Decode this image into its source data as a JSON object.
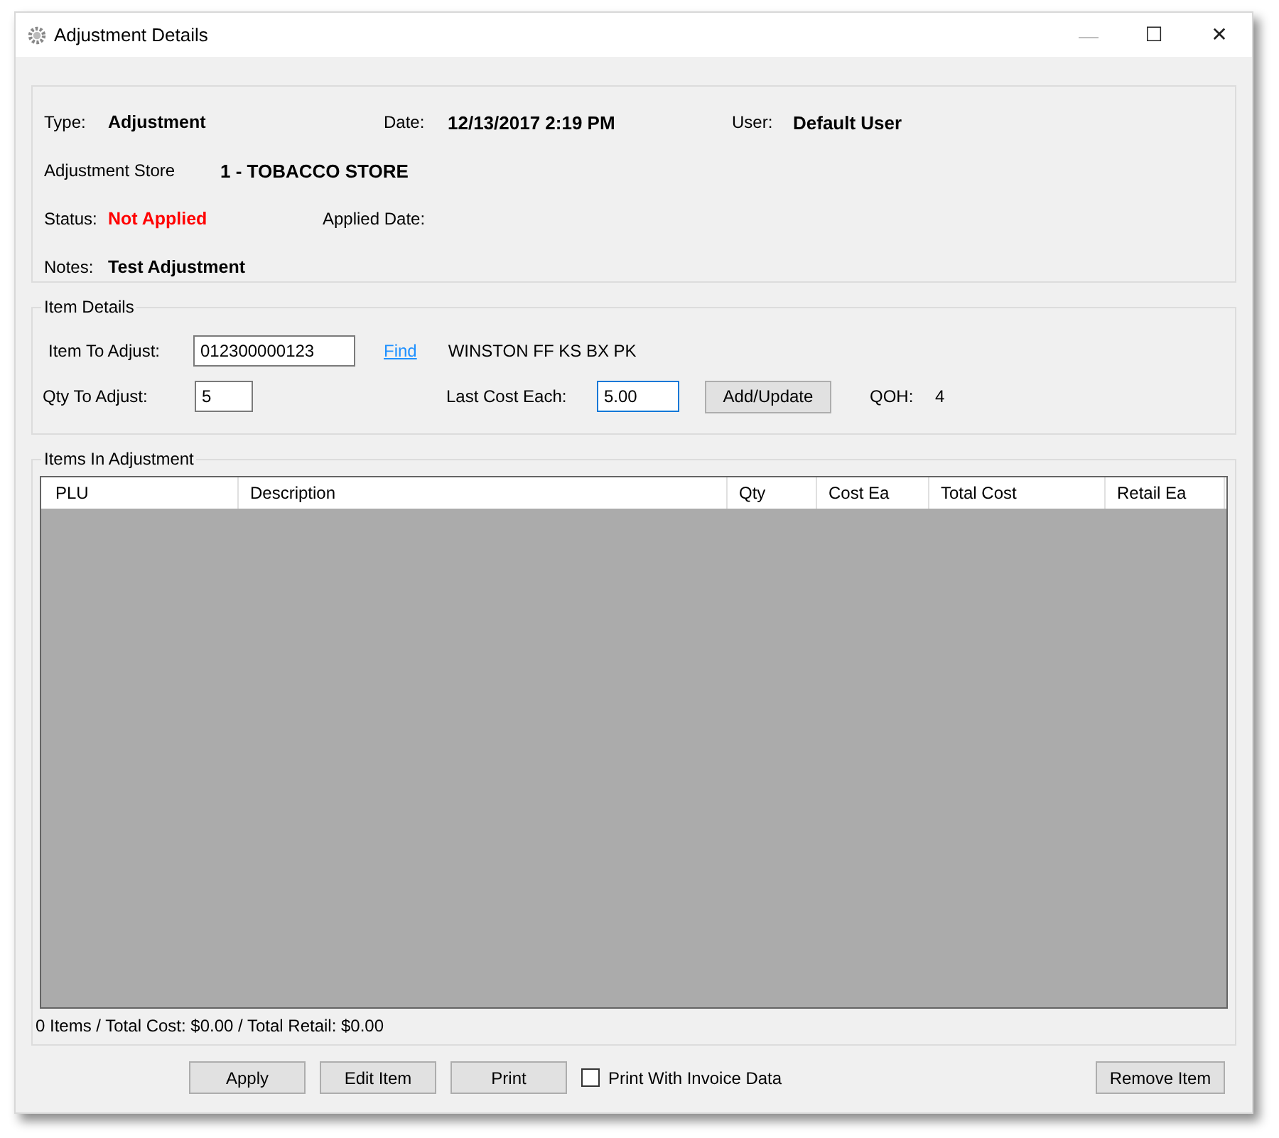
{
  "window": {
    "title": "Adjustment Details",
    "controls": [
      "—",
      "☐",
      "✕"
    ]
  },
  "header": {
    "type_label": "Type:",
    "type_value": "Adjustment",
    "date_label": "Date:",
    "date_value": "12/13/2017 2:19 PM",
    "user_label": "User:",
    "user_value": "Default User",
    "store_label": "Adjustment Store",
    "store_value": "1 - TOBACCO STORE",
    "status_label": "Status:",
    "status_value": "Not Applied",
    "applied_date_label": "Applied Date:",
    "notes_label": "Notes:",
    "notes_value": "Test Adjustment"
  },
  "item_details": {
    "title": "Item Details",
    "item_label": "Item To Adjust:",
    "item_value": "012300000123",
    "find_link": "Find",
    "item_description": "WINSTON FF KS BX PK",
    "qty_label": "Qty To Adjust:",
    "qty_value": "5",
    "cost_label": "Last Cost Each:",
    "cost_value": "5.00",
    "cost_focused": true,
    "add_button": "Add/Update",
    "qoh_label": "QOH:",
    "qoh_value": "4"
  },
  "items_in_adjustment": {
    "title": "Items In Adjustment",
    "table": {
      "columns": [
        "PLU",
        "Description",
        "Qty",
        "Cost Ea",
        "Total Cost",
        "Retail Ea"
      ]
    },
    "summary": "0 Items / Total Cost: $0.00 / Total Retail: $0.00"
  },
  "buttons": [
    {
      "label": "Apply",
      "kind": "button"
    },
    {
      "label": "Edit Item",
      "kind": "button"
    },
    {
      "label": "Print",
      "kind": "button"
    },
    {
      "label": "Print With Invoice Data",
      "kind": "checkbox",
      "checked": false
    },
    {
      "label": "Remove Item",
      "kind": "button"
    }
  ]
}
